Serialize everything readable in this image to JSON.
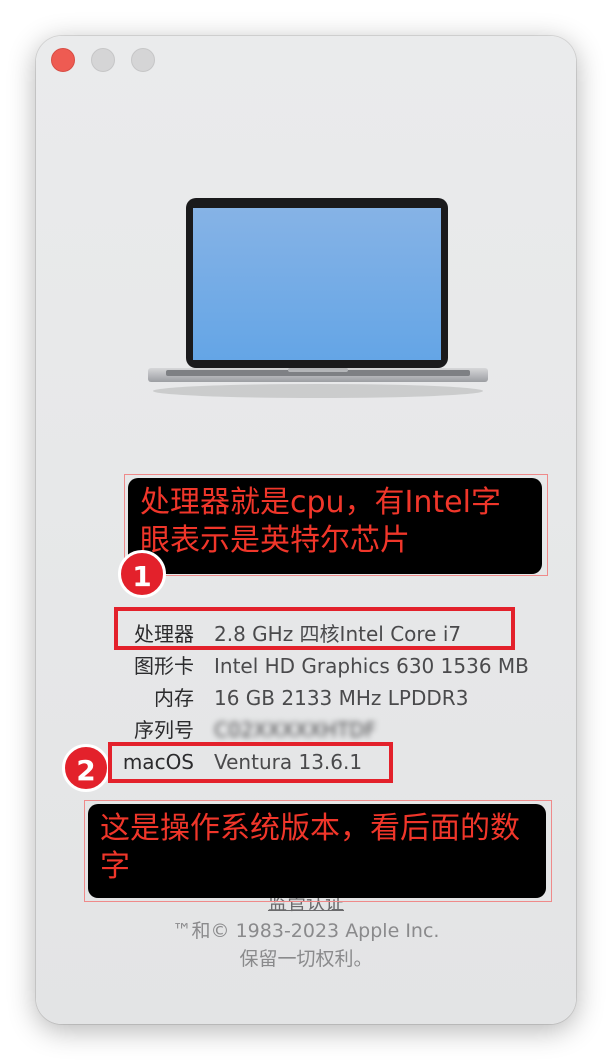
{
  "window": {
    "controls": [
      {
        "name": "close",
        "color": "#ee5b52"
      },
      {
        "name": "minimize",
        "color": "#d5d5d6"
      },
      {
        "name": "maximize",
        "color": "#d5d5d6"
      }
    ]
  },
  "specs": [
    {
      "label": "处理器",
      "value": "2.8 GHz 四核Intel Core i7"
    },
    {
      "label": "图形卡",
      "value": "Intel HD Graphics 630 1536 MB"
    },
    {
      "label": "内存",
      "value": "16 GB 2133 MHz LPDDR3"
    },
    {
      "label": "序列号",
      "value": "C02XXXXXHTDF"
    },
    {
      "label": "macOS",
      "value": "Ventura 13.6.1"
    }
  ],
  "footer": {
    "link": "监管认证",
    "copyright": "™和© 1983-2023 Apple Inc.",
    "rights": "保留一切权利。"
  },
  "annotations": {
    "box1_text": "处理器就是cpu，有Intel字眼表示是英特尔芯片",
    "box2_text": "这是操作系统版本，看后面的数字",
    "badge1": "1",
    "badge2": "2",
    "color": "#e3212b"
  }
}
